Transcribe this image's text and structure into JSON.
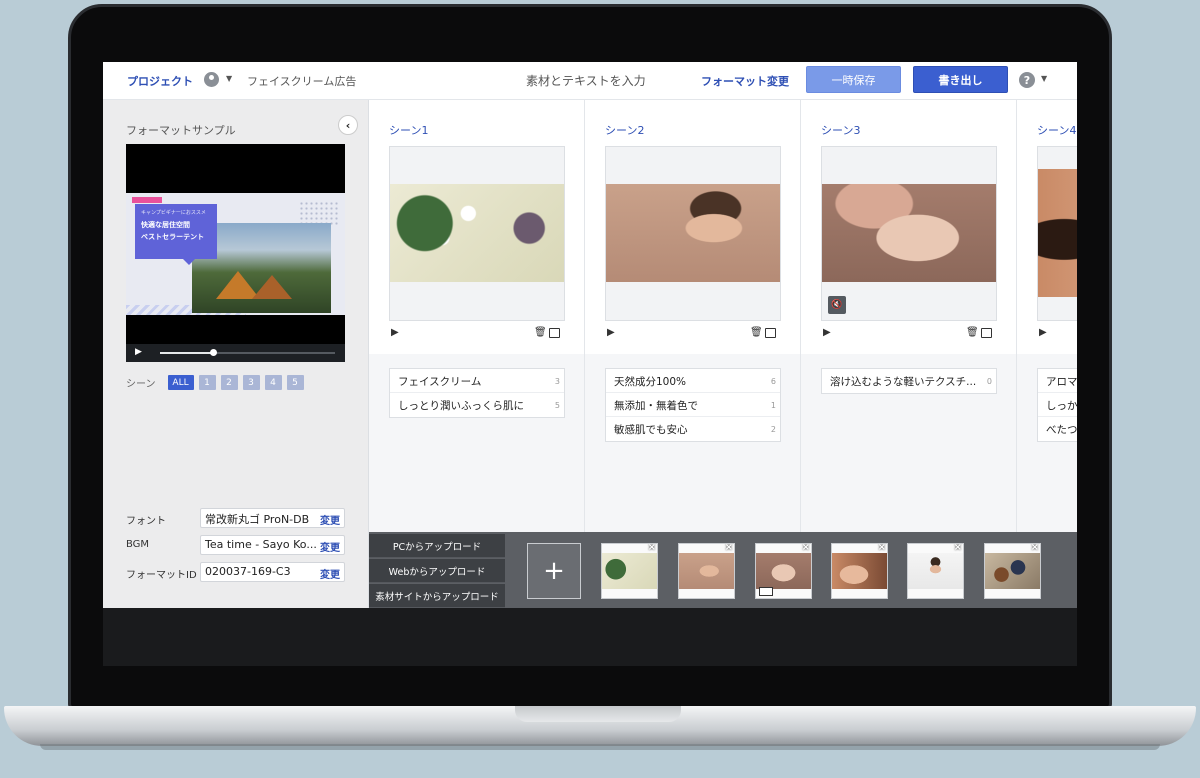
{
  "header": {
    "project_label": "プロジェクト",
    "project_name": "フェイスクリーム広告",
    "mode_title": "素材とテキストを入力",
    "format_change": "フォーマット変更",
    "save_label": "一時保存",
    "export_label": "書き出し",
    "help": "?"
  },
  "left_panel": {
    "title": "フォーマットサンプル",
    "collapse_icon": "‹",
    "preview": {
      "small_text": "キャンプビギナーにおススメ",
      "line1": "快適な居住空間",
      "line2": "ベストセラーテント",
      "progress": 0.3
    },
    "scene_label": "シーン",
    "scene_pills": [
      "ALL",
      "1",
      "2",
      "3",
      "4",
      "5"
    ],
    "settings": [
      {
        "label": "フォント",
        "value": "常改新丸ゴ ProN-DB",
        "action": "変更"
      },
      {
        "label": "BGM",
        "value": "Tea time - Sayo Ko...",
        "action": "変更"
      },
      {
        "label": "フォーマットID",
        "value": "020037-169-C3",
        "action": "変更"
      }
    ]
  },
  "scenes": [
    {
      "title": "シーン1",
      "texts": [
        {
          "text": "フェイスクリーム",
          "count": "3"
        },
        {
          "text": "しっとり潤いふっくら肌に",
          "count": "5"
        }
      ]
    },
    {
      "title": "シーン2",
      "texts": [
        {
          "text": "天然成分100%",
          "count": "6"
        },
        {
          "text": "無添加・無着色で",
          "count": "1"
        },
        {
          "text": "敏感肌でも安心",
          "count": "2"
        }
      ]
    },
    {
      "title": "シーン3",
      "texts": [
        {
          "text": "溶け込むような軽いテクスチ...",
          "count": "0"
        }
      ]
    },
    {
      "title": "シーン4",
      "texts": [
        {
          "text": "アロマ",
          "count": ""
        },
        {
          "text": "しっか",
          "count": ""
        },
        {
          "text": "べたつ",
          "count": ""
        }
      ]
    }
  ],
  "upload": {
    "from_pc": "PCからアップロード",
    "from_web": "Webからアップロード",
    "from_stock": "素材サイトからアップロード",
    "add_icon": "+",
    "remove_icon": "×"
  },
  "colors": {
    "accent": "#3b5fd0",
    "accent_light": "#7a9ae8",
    "link": "#2e4fb4",
    "upload_bar": "#5c5f64"
  }
}
